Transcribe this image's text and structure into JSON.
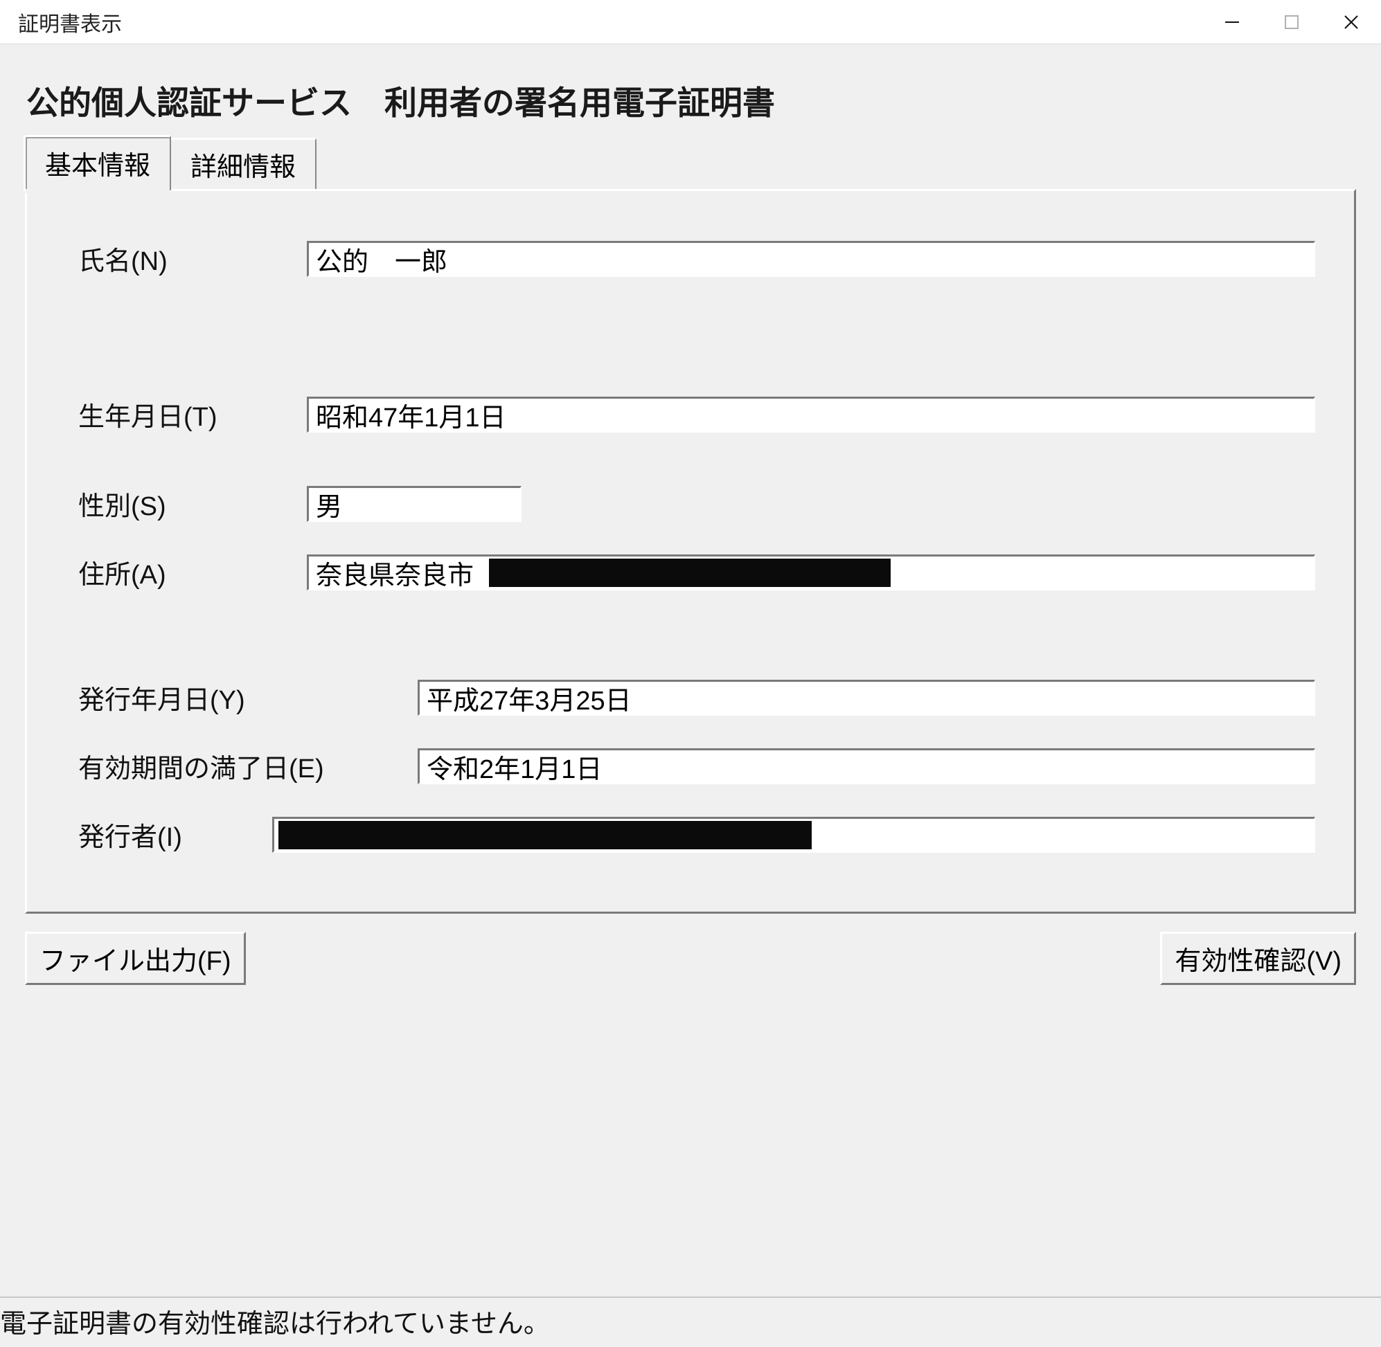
{
  "window": {
    "title": "証明書表示"
  },
  "heading": "公的個人認証サービス　利用者の署名用電子証明書",
  "tabs": {
    "basic": "基本情報",
    "detail": "詳細情報"
  },
  "labels": {
    "name": "氏名(N)",
    "birthdate": "生年月日(T)",
    "sex": "性別(S)",
    "address": "住所(A)",
    "issue_date": "発行年月日(Y)",
    "expiry_date": "有効期間の満了日(E)",
    "issuer": "発行者(I)"
  },
  "values": {
    "name": "公的　一郎",
    "birthdate": "昭和47年1月1日",
    "sex": "男",
    "address_prefix": "奈良県奈良市",
    "address_redacted": true,
    "issue_date": "平成27年3月25日",
    "expiry_date": "令和2年1月1日",
    "issuer": "",
    "issuer_redacted": true
  },
  "buttons": {
    "file_output": "ファイル出力(F)",
    "validate": "有効性確認(V)"
  },
  "status": "電子証明書の有効性確認は行われていません。"
}
